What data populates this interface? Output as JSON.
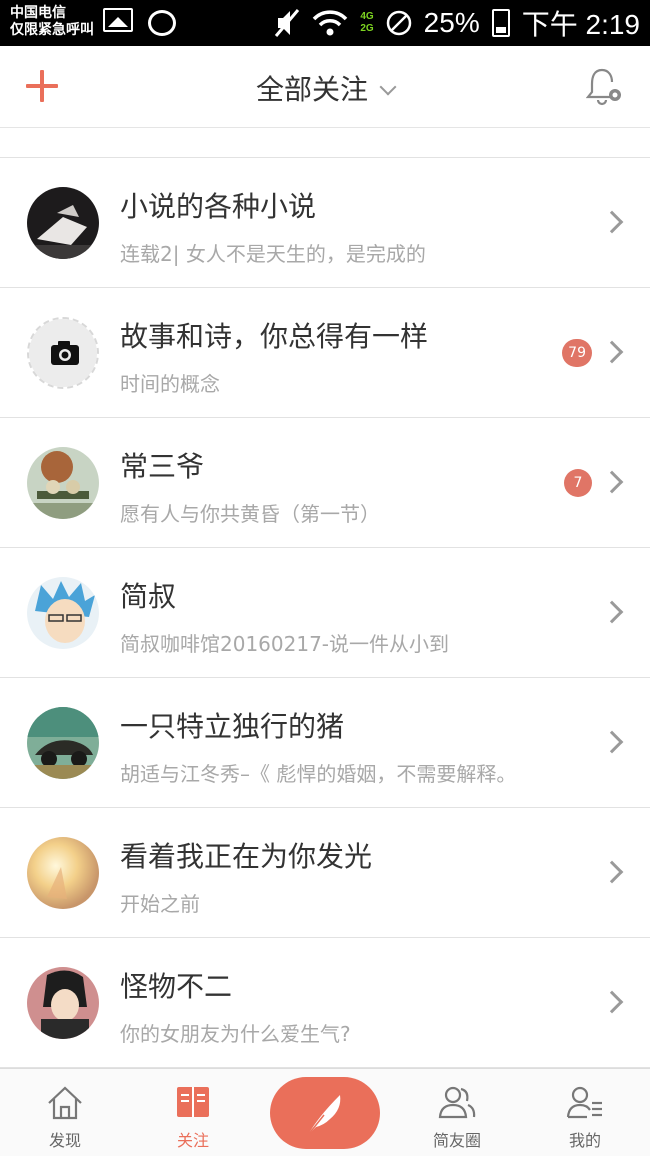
{
  "status_bar": {
    "carrier_line1": "中国电信",
    "carrier_line2": "仅限紧急呼叫",
    "network": "4G",
    "network2": "2G",
    "battery": "25%",
    "time": "下午 2:19"
  },
  "header": {
    "title": "全部关注"
  },
  "subscriptions": [
    {
      "name": "小说的各种小说",
      "latest": "连载2| 女人不是天生的，是完成的",
      "badge": ""
    },
    {
      "name": "故事和诗，你总得有一样",
      "latest": "时间的概念",
      "badge": "79"
    },
    {
      "name": "常三爷",
      "latest": "愿有人与你共黄昏（第一节）",
      "badge": "7"
    },
    {
      "name": "简叔",
      "latest": "简叔咖啡馆20160217-说一件从小到",
      "badge": ""
    },
    {
      "name": "一只特立独行的猪",
      "latest": "胡适与江冬秀–《 彪悍的婚姻，不需要解释。",
      "badge": ""
    },
    {
      "name": "看着我正在为你发光",
      "latest": "开始之前",
      "badge": ""
    },
    {
      "name": "怪物不二",
      "latest": "你的女朋友为什么爱生气?",
      "badge": ""
    }
  ],
  "tabbar": {
    "discover": "发现",
    "follow": "关注",
    "friends": "简友圈",
    "mine": "我的"
  },
  "colors": {
    "accent": "#ea6f5a",
    "badge": "#e07566"
  }
}
